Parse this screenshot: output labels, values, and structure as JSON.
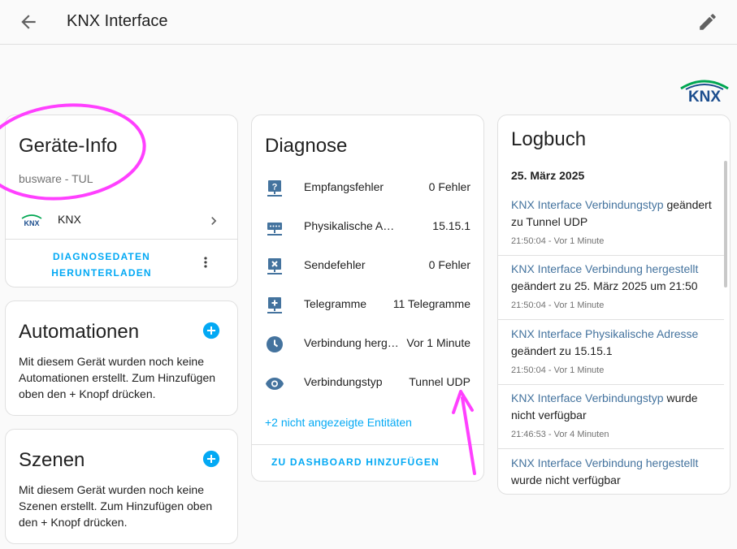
{
  "header": {
    "title": "KNX Interface",
    "back_icon": "arrow-left-icon",
    "edit_icon": "pencil-icon"
  },
  "brand": {
    "logo_text": "KNX",
    "colors": {
      "green": "#00a651",
      "blue": "#1c4e8e"
    }
  },
  "device_info": {
    "title": "Geräte-Info",
    "manufacturer_model": "busware - TUL",
    "integration_label": "KNX",
    "download_label_line1": "DIAGNOSEDATEN",
    "download_label_line2": "HERUNTERLADEN"
  },
  "automations": {
    "title": "Automationen",
    "empty_text": "Mit diesem Gerät wurden noch keine Automationen erstellt. Zum Hinzufügen oben den + Knopf drücken."
  },
  "scenes": {
    "title": "Szenen",
    "empty_text": "Mit diesem Gerät wurden noch keine Szenen erstellt. Zum Hinzufügen oben den + Knopf drücken."
  },
  "diagnose": {
    "title": "Diagnose",
    "rows": [
      {
        "icon": "help-network-icon",
        "name": "Empfangsfehler",
        "value": "0 Fehler"
      },
      {
        "icon": "ethernet-network-icon",
        "name": "Physikalische Adresse",
        "value": "15.15.1"
      },
      {
        "icon": "close-network-icon",
        "name": "Sendefehler",
        "value": "0 Fehler"
      },
      {
        "icon": "plus-network-icon",
        "name": "Telegramme",
        "value": "11 Telegramme"
      },
      {
        "icon": "clock-icon",
        "name": "Verbindung hergestellt",
        "value": "Vor 1 Minute"
      },
      {
        "icon": "eye-icon",
        "name": "Verbindungstyp",
        "value": "Tunnel UDP"
      }
    ],
    "hidden_entities_link": "+2 nicht angezeigte Entitäten",
    "add_to_dashboard": "ZU DASHBOARD HINZUFÜGEN"
  },
  "logbook": {
    "title": "Logbuch",
    "date": "25. März 2025",
    "entries": [
      {
        "entity": "KNX Interface Verbindungstyp",
        "change": " geändert zu Tunnel UDP",
        "time": "21:50:04 - Vor 1 Minute"
      },
      {
        "entity": "KNX Interface Verbindung hergestellt",
        "change": " geändert zu 25. März 2025 um 21:50",
        "time": "21:50:04 - Vor 1 Minute"
      },
      {
        "entity": "KNX Interface Physikalische Adresse",
        "change": " geändert zu 15.15.1",
        "time": "21:50:04 - Vor 1 Minute"
      },
      {
        "entity": "KNX Interface Verbindungstyp",
        "change": " wurde nicht verfügbar",
        "time": "21:46:53 - Vor 4 Minuten"
      },
      {
        "entity": "KNX Interface Verbindung hergestellt",
        "change": " wurde nicht verfügbar",
        "time": ""
      }
    ]
  },
  "colors": {
    "primary": "#03a9f4",
    "icon": "#44739e",
    "annotation": "#ff40ff"
  }
}
